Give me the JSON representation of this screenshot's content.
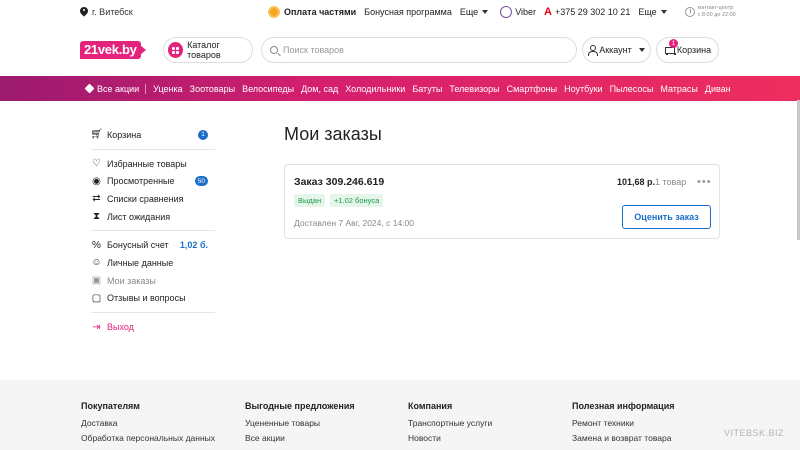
{
  "topbar": {
    "city": "г. Витебск",
    "installment": "Оплата частями",
    "bonus_program": "Бонусная программа",
    "more1": "Еще",
    "viber": "Viber",
    "phone": "+375 29 302 10 21",
    "more2": "Еще",
    "contact_center": "контакт-центр",
    "hours": "с 8:00 до 22:00"
  },
  "header": {
    "logo": "21vek.by",
    "catalog": "Каталог товаров",
    "search_placeholder": "Поиск товаров",
    "account": "Аккаунт",
    "cart": "Корзина",
    "cart_count": "1"
  },
  "nav": {
    "items": [
      "Все акции",
      "Уценка",
      "Зоотовары",
      "Велосипеды",
      "Дом, сад",
      "Холодильники",
      "Батуты",
      "Телевизоры",
      "Смартфоны",
      "Ноутбуки",
      "Пылесосы",
      "Матрасы",
      "Диван"
    ]
  },
  "sidebar": {
    "cart": "Корзина",
    "cart_badge": "1",
    "favorites": "Избранные товары",
    "viewed": "Просмотренные",
    "viewed_badge": "50",
    "compare": "Списки сравнения",
    "waitlist": "Лист ожидания",
    "bonus_account": "Бонусный счет",
    "bonus_value": "1,02 б.",
    "personal": "Личные данные",
    "orders": "Мои заказы",
    "reviews": "Отзывы и вопросы",
    "logout": "Выход"
  },
  "main": {
    "title": "Мои заказы",
    "order": {
      "number": "Заказ 309.246.619",
      "price": "101,68 р.",
      "count": "1 товар",
      "status": "Выдан",
      "bonus": "+1.02 бонуса",
      "delivered": "Доставлен 7 Авг, 2024, с 14:00",
      "rate_button": "Оценить заказ"
    }
  },
  "footer": {
    "col1": {
      "title": "Покупателям",
      "links": [
        "Доставка",
        "Обработка персональных данных"
      ]
    },
    "col2": {
      "title": "Выгодные предложения",
      "links": [
        "Уцененные товары",
        "Все акции"
      ]
    },
    "col3": {
      "title": "Компания",
      "links": [
        "Транспортные услуги",
        "Новости"
      ]
    },
    "col4": {
      "title": "Полезная информация",
      "links": [
        "Ремонт техники",
        "Замена и возврат товара"
      ]
    }
  },
  "watermark": "VITEBSK.BIZ",
  "colors": {
    "brand": "#e4237d",
    "accent": "#1a6ec7",
    "success": "#1a9b4a"
  }
}
